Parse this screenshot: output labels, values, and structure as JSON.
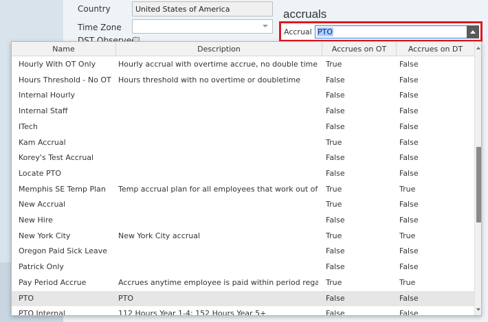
{
  "form": {
    "country_label": "Country",
    "country_value": "United States of America",
    "timezone_label": "Time Zone",
    "timezone_value": "",
    "dst_label": "DST Observed"
  },
  "accruals": {
    "section_title": "accruals",
    "accrual_label": "Accrual",
    "accrual_value": "PTO"
  },
  "grid": {
    "columns": [
      "Name",
      "Description",
      "Accrues on OT",
      "Accrues on DT"
    ],
    "rows": [
      {
        "name": "Hourly With OT Only",
        "description": "Hourly accrual with overtime accrue, no double time",
        "ot": "True",
        "dt": "False"
      },
      {
        "name": "Hours Threshold - No OT",
        "description": "Hours threshold with no overtime or doubletime",
        "ot": "False",
        "dt": "False"
      },
      {
        "name": "Internal Hourly",
        "description": "",
        "ot": "False",
        "dt": "False"
      },
      {
        "name": "Internal Staff",
        "description": "",
        "ot": "False",
        "dt": "False"
      },
      {
        "name": "ITech",
        "description": "",
        "ot": "False",
        "dt": "False"
      },
      {
        "name": "Kam Accrual",
        "description": "",
        "ot": "True",
        "dt": "False"
      },
      {
        "name": "Korey's Test Accrual",
        "description": "",
        "ot": "False",
        "dt": "False"
      },
      {
        "name": "Locate PTO",
        "description": "",
        "ot": "False",
        "dt": "False"
      },
      {
        "name": "Memphis SE Temp Plan",
        "description": "Temp accrual plan for all employees that work out of th",
        "ot": "True",
        "dt": "True"
      },
      {
        "name": "New Accrual",
        "description": "",
        "ot": "True",
        "dt": "False"
      },
      {
        "name": "New Hire",
        "description": "",
        "ot": "False",
        "dt": "False"
      },
      {
        "name": "New York City",
        "description": "New York City accrual",
        "ot": "True",
        "dt": "True"
      },
      {
        "name": "Oregon Paid Sick Leave",
        "description": "",
        "ot": "False",
        "dt": "False"
      },
      {
        "name": "Patrick Only",
        "description": "",
        "ot": "False",
        "dt": "False"
      },
      {
        "name": "Pay Period Accrue",
        "description": "Accrues anytime employee is paid within period regard",
        "ot": "True",
        "dt": "True"
      },
      {
        "name": "PTO",
        "description": "PTO",
        "ot": "False",
        "dt": "False",
        "selected": true
      },
      {
        "name": "PTO Internal",
        "description": "112 Hours Year 1-4; 152 Hours Year 5+",
        "ot": "False",
        "dt": "False"
      }
    ]
  }
}
